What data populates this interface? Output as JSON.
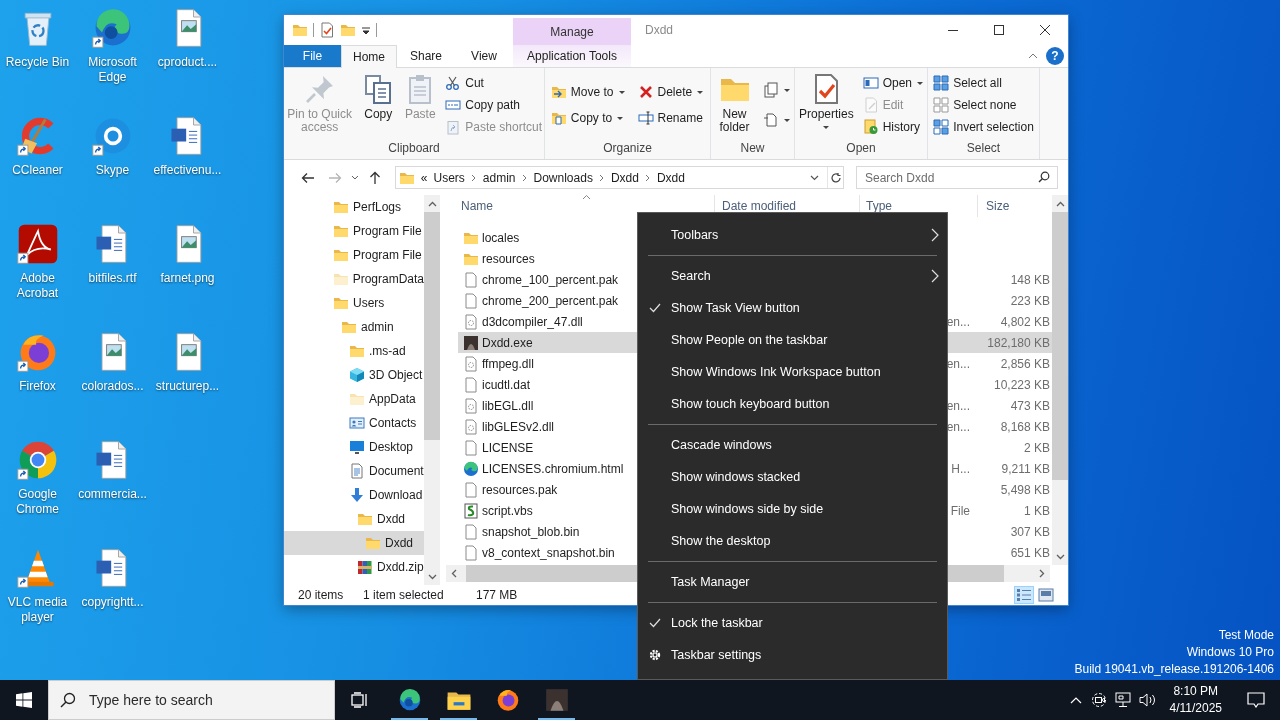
{
  "desktop": {
    "icons": [
      {
        "label": "Recycle Bin",
        "kind": "recycle",
        "shortcut": false
      },
      {
        "label": "CCleaner",
        "kind": "ccleaner",
        "shortcut": true
      },
      {
        "label": "Adobe Acrobat",
        "kind": "acrobat",
        "shortcut": true
      },
      {
        "label": "Firefox",
        "kind": "firefox",
        "shortcut": true
      },
      {
        "label": "Google Chrome",
        "kind": "chrome",
        "shortcut": true
      },
      {
        "label": "VLC media player",
        "kind": "vlc",
        "shortcut": true
      },
      {
        "label": "Microsoft Edge",
        "kind": "edge",
        "shortcut": true
      },
      {
        "label": "Skype",
        "kind": "skype",
        "shortcut": true
      },
      {
        "label": "bitfiles.rtf",
        "kind": "word",
        "shortcut": false
      },
      {
        "label": "colorados...",
        "kind": "image",
        "shortcut": false
      },
      {
        "label": "commercia...",
        "kind": "word",
        "shortcut": false
      },
      {
        "label": "copyrightt...",
        "kind": "word",
        "shortcut": false
      },
      {
        "label": "cproduct....",
        "kind": "image",
        "shortcut": false
      },
      {
        "label": "effectivenu...",
        "kind": "word",
        "shortcut": false
      },
      {
        "label": "farnet.png",
        "kind": "image",
        "shortcut": false
      },
      {
        "label": "structurep...",
        "kind": "image",
        "shortcut": false
      }
    ]
  },
  "system_info": [
    "Test Mode",
    "Windows 10 Pro",
    "Build 19041.vb_release.191206-1406"
  ],
  "explorer": {
    "title": "Dxdd",
    "context_tab_group": "Manage",
    "help_button": "?",
    "tabs": [
      {
        "label": "File",
        "kind": "file",
        "selected": false
      },
      {
        "label": "Home",
        "kind": "tab",
        "selected": true
      },
      {
        "label": "Share",
        "kind": "tab",
        "selected": false
      },
      {
        "label": "View",
        "kind": "tab",
        "selected": false
      },
      {
        "label": "Application Tools",
        "kind": "context",
        "selected": false
      }
    ],
    "ribbon": {
      "groups": [
        {
          "label": "Clipboard",
          "columns": [
            [
              {
                "label": "Pin to Quick access",
                "disabled": true,
                "dropdown": false
              }
            ],
            [
              {
                "label": "Copy",
                "disabled": false,
                "dropdown": false
              }
            ],
            [
              {
                "label": "Paste",
                "disabled": true,
                "dropdown": false
              }
            ],
            [
              {
                "label": "Cut",
                "disabled": false,
                "dropdown": false
              },
              {
                "label": "Copy path",
                "disabled": false,
                "dropdown": false
              },
              {
                "label": "Paste shortcut",
                "disabled": true,
                "dropdown": false
              }
            ]
          ]
        },
        {
          "label": "Organize",
          "columns": [
            [
              {
                "label": "Move to",
                "disabled": false,
                "dropdown": true
              },
              {
                "label": "Copy to",
                "disabled": false,
                "dropdown": true
              }
            ],
            [
              {
                "label": "Delete",
                "disabled": false,
                "dropdown": true
              },
              {
                "label": "Rename",
                "disabled": false,
                "dropdown": false
              }
            ]
          ]
        },
        {
          "label": "New",
          "columns": [
            [
              {
                "label": "New folder",
                "disabled": false,
                "dropdown": false
              }
            ],
            [
              {
                "disabled": false,
                "dropdown": true
              },
              {
                "disabled": false,
                "dropdown": true
              }
            ]
          ]
        },
        {
          "label": "Open",
          "columns": [
            [
              {
                "label": "Properties",
                "disabled": false,
                "dropdown": true
              }
            ],
            [
              {
                "label": "Open",
                "disabled": false,
                "dropdown": true
              },
              {
                "label": "Edit",
                "disabled": true,
                "dropdown": false
              },
              {
                "label": "History",
                "disabled": false,
                "dropdown": false
              }
            ]
          ]
        },
        {
          "label": "Select",
          "columns": [
            [
              {
                "label": "Select all",
                "disabled": false,
                "dropdown": false
              },
              {
                "label": "Select none",
                "disabled": false,
                "dropdown": false
              },
              {
                "label": "Invert selection",
                "disabled": false,
                "dropdown": false
              }
            ]
          ]
        }
      ]
    },
    "address": {
      "overflow_mark": "«",
      "path": [
        "Users",
        "admin",
        "Downloads",
        "Dxdd",
        "Dxdd"
      ],
      "search_placeholder": "Search Dxdd"
    },
    "nav": [
      {
        "label": "PerfLogs",
        "kind": "folder",
        "selected": false
      },
      {
        "label": "Program File",
        "kind": "folder",
        "selected": false
      },
      {
        "label": "Program File",
        "kind": "folder",
        "selected": false
      },
      {
        "label": "ProgramData",
        "kind": "folder-hidden",
        "selected": false
      },
      {
        "label": "Users",
        "kind": "folder",
        "selected": false,
        "children": [
          {
            "label": "admin",
            "kind": "folder",
            "selected": false,
            "children": [
              {
                "label": ".ms-ad",
                "kind": "folder",
                "selected": false
              },
              {
                "label": "3D Object",
                "kind": "cube",
                "selected": false
              },
              {
                "label": "AppData",
                "kind": "folder-hidden",
                "selected": false
              },
              {
                "label": "Contacts",
                "kind": "contacts",
                "selected": false
              },
              {
                "label": "Desktop",
                "kind": "desktop",
                "selected": false
              },
              {
                "label": "Document",
                "kind": "documents",
                "selected": false
              },
              {
                "label": "Download",
                "kind": "downloads",
                "selected": false,
                "children": [
                  {
                    "label": "Dxdd",
                    "kind": "folder",
                    "selected": false,
                    "children": [
                      {
                        "label": "Dxdd",
                        "kind": "folder",
                        "selected": true
                      }
                    ]
                  },
                  {
                    "label": "Dxdd.zip",
                    "kind": "archive",
                    "selected": false
                  }
                ]
              }
            ]
          }
        ]
      }
    ],
    "columns": [
      "Name",
      "Date modified",
      "Type",
      "Size"
    ],
    "files": [
      {
        "name": "locales",
        "kind": "folder",
        "selected": false
      },
      {
        "name": "resources",
        "kind": "folder",
        "selected": false
      },
      {
        "name": "chrome_100_percent.pak",
        "kind": "file",
        "size": "148 KB",
        "selected": false
      },
      {
        "name": "chrome_200_percent.pak",
        "kind": "file",
        "size": "223 KB",
        "selected": false
      },
      {
        "name": "d3dcompiler_47.dll",
        "kind": "dll",
        "type": "en...",
        "size": "4,802 KB",
        "selected": false
      },
      {
        "name": "Dxdd.exe",
        "kind": "app",
        "size": "182,180 KB",
        "selected": true
      },
      {
        "name": "ffmpeg.dll",
        "kind": "dll",
        "type": "en...",
        "size": "2,856 KB",
        "selected": false
      },
      {
        "name": "icudtl.dat",
        "kind": "file",
        "size": "10,223 KB",
        "selected": false
      },
      {
        "name": "libEGL.dll",
        "kind": "dll",
        "type": "en...",
        "size": "473 KB",
        "selected": false
      },
      {
        "name": "libGLESv2.dll",
        "kind": "dll",
        "type": "en...",
        "size": "8,168 KB",
        "selected": false
      },
      {
        "name": "LICENSE",
        "kind": "file",
        "size": "2 KB",
        "selected": false
      },
      {
        "name": "LICENSES.chromium.html",
        "kind": "edge",
        "type": "H...",
        "size": "9,211 KB",
        "selected": false
      },
      {
        "name": "resources.pak",
        "kind": "file",
        "size": "5,498 KB",
        "selected": false
      },
      {
        "name": "script.vbs",
        "kind": "script",
        "type": "File",
        "size": "1 KB",
        "selected": false
      },
      {
        "name": "snapshot_blob.bin",
        "kind": "file",
        "size": "307 KB",
        "selected": false
      },
      {
        "name": "v8_context_snapshot.bin",
        "kind": "file",
        "size": "651 KB",
        "selected": false
      }
    ],
    "status": {
      "items": "20 items",
      "selection": "1 item selected",
      "size": "177 MB"
    },
    "views": [
      {
        "kind": "details",
        "selected": true
      },
      {
        "kind": "thumbnails",
        "selected": false
      }
    ]
  },
  "context_menu": {
    "items": [
      {
        "kind": "submenu",
        "label": "Toolbars"
      },
      {
        "kind": "separator"
      },
      {
        "kind": "submenu",
        "label": "Search"
      },
      {
        "kind": "toggle",
        "label": "Show Task View button",
        "checked": true
      },
      {
        "kind": "toggle",
        "label": "Show People on the taskbar",
        "checked": false
      },
      {
        "kind": "toggle",
        "label": "Show Windows Ink Workspace button",
        "checked": false
      },
      {
        "kind": "toggle",
        "label": "Show touch keyboard button",
        "checked": false
      },
      {
        "kind": "separator"
      },
      {
        "kind": "action",
        "label": "Cascade windows"
      },
      {
        "kind": "action",
        "label": "Show windows stacked"
      },
      {
        "kind": "action",
        "label": "Show windows side by side"
      },
      {
        "kind": "action",
        "label": "Show the desktop"
      },
      {
        "kind": "separator"
      },
      {
        "kind": "action",
        "label": "Task Manager"
      },
      {
        "kind": "separator"
      },
      {
        "kind": "toggle",
        "label": "Lock the taskbar",
        "checked": true
      },
      {
        "kind": "settings",
        "label": "Taskbar settings"
      }
    ]
  },
  "taskbar": {
    "search_placeholder": "Type here to search",
    "apps": [
      {
        "kind": "edge",
        "running": true
      },
      {
        "kind": "explorer",
        "running": true
      },
      {
        "kind": "firefox",
        "running": false
      },
      {
        "kind": "app",
        "running": true
      }
    ],
    "time": "8:10 PM",
    "date": "4/11/2025"
  }
}
